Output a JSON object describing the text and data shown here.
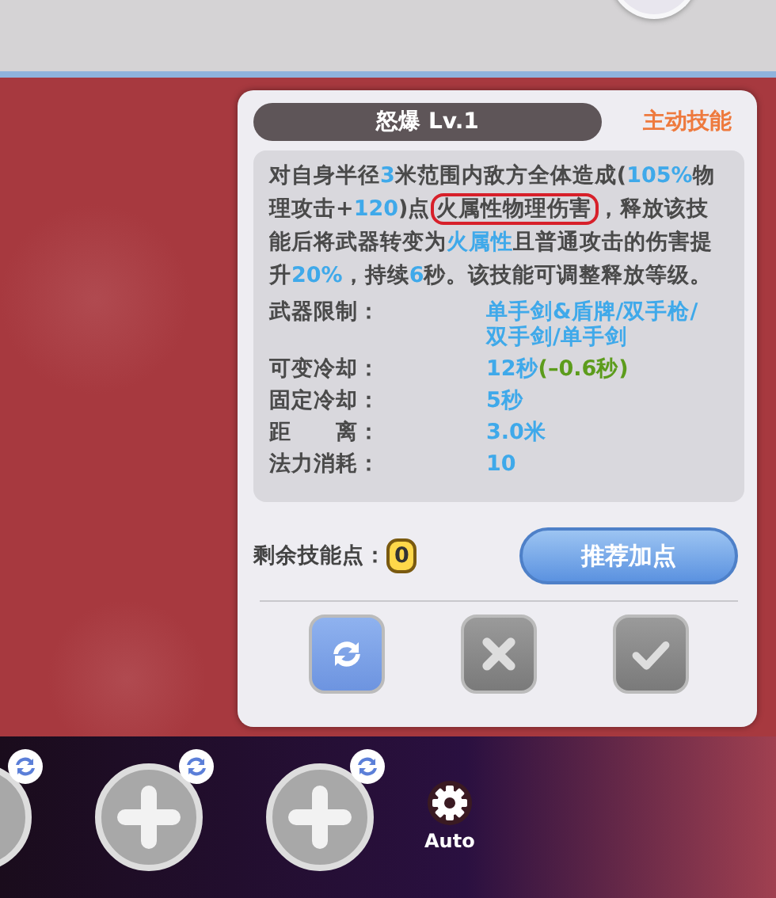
{
  "skill_card": {
    "title": "怒爆 Lv.1",
    "type_label": "主动技能",
    "description": [
      {
        "kind": "text",
        "text": "对自身半径"
      },
      {
        "kind": "value",
        "text": "3"
      },
      {
        "kind": "text",
        "text": "米范围内敌方全体造成("
      },
      {
        "kind": "value",
        "text": "105%"
      },
      {
        "kind": "text",
        "text": "物理攻击+"
      },
      {
        "kind": "value",
        "text": "120"
      },
      {
        "kind": "text",
        "text": ")点"
      },
      {
        "kind": "marked",
        "text": "火属性物理伤害"
      },
      {
        "kind": "text",
        "text": "，释放该技能后将武器转变为"
      },
      {
        "kind": "value",
        "text": "火属性"
      },
      {
        "kind": "text",
        "text": "且普通攻击的伤害提升"
      },
      {
        "kind": "value",
        "text": "20%"
      },
      {
        "kind": "text",
        "text": "，持续"
      },
      {
        "kind": "value",
        "text": "6"
      },
      {
        "kind": "text",
        "text": "秒。该技能可调整释放等级。"
      }
    ],
    "stats": [
      {
        "label": "武器限制：",
        "value": "单手剑&盾牌/双手枪/双手剑/单手剑"
      },
      {
        "label": "可变冷却：",
        "value": "12秒",
        "bonus": "(–0.6秒)"
      },
      {
        "label": "固定冷却：",
        "value": "5秒"
      },
      {
        "label": "距　　离：",
        "value": "3.0米"
      },
      {
        "label": "法力消耗：",
        "value": "10"
      }
    ]
  },
  "skill_points": {
    "label": "剩余技能点：",
    "value": "0"
  },
  "recommend_button": "推荐加点",
  "actions": [
    {
      "kind": "reset",
      "disabled": false
    },
    {
      "kind": "cancel",
      "disabled": true
    },
    {
      "kind": "confirm",
      "disabled": true
    }
  ],
  "auto_button": {
    "label": "Auto"
  }
}
